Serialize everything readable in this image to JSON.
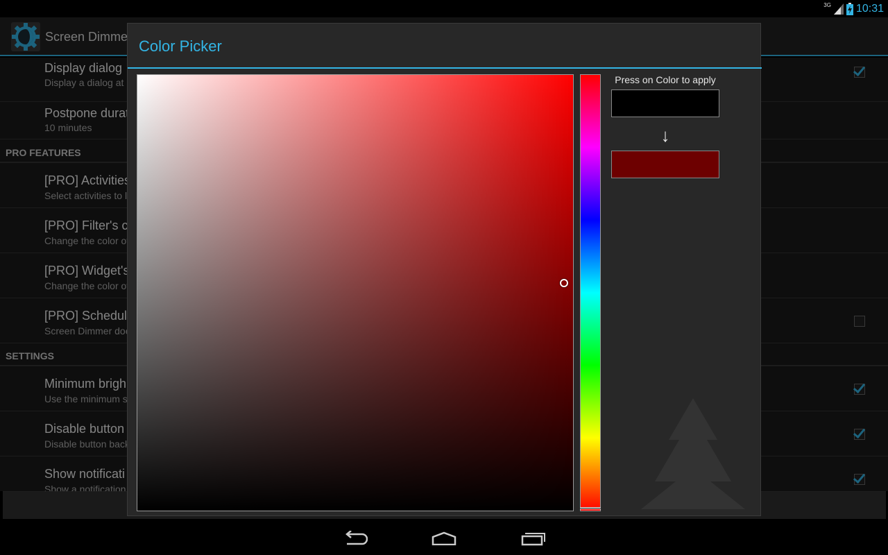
{
  "status_bar": {
    "network_type": "3G",
    "time": "10:31"
  },
  "app": {
    "title": "Screen Dimmer"
  },
  "preferences": {
    "items": [
      {
        "title": "Display dialog",
        "summary": "Display a dialog at",
        "checked": true
      },
      {
        "title": "Postpone durat",
        "summary": "10 minutes"
      },
      {
        "title": "[PRO] Activities",
        "summary": "Select activities to l"
      },
      {
        "title": "[PRO] Filter's co",
        "summary": "Change the color of"
      },
      {
        "title": "[PRO] Widget's",
        "summary": "Change the color of"
      },
      {
        "title": "[PRO] Schedule",
        "summary": "Screen Dimmer doe",
        "checked": false
      },
      {
        "title": "Minimum brigh",
        "summary": "Use the minimum s",
        "checked": true
      },
      {
        "title": "Disable button",
        "summary": "Disable button back",
        "checked": true
      },
      {
        "title": "Show notificati",
        "summary": "Show a notification",
        "checked": true
      }
    ],
    "headers": [
      "PRO FEATURES",
      "SETTINGS"
    ]
  },
  "dialog": {
    "title": "Color Picker",
    "apply_label": "Press on Color to apply",
    "arrow": "↓",
    "hue": "#ff0000",
    "old_color": "#000000",
    "new_color": "#6d0000",
    "saturation": 1.0,
    "brightness": 0.43
  },
  "navbar": {
    "buttons": [
      "back-icon",
      "home-icon",
      "recent-apps-icon"
    ]
  }
}
